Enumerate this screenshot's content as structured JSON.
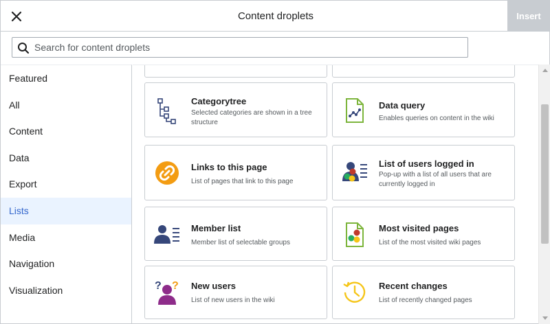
{
  "header": {
    "title": "Content droplets",
    "insert_label": "Insert",
    "close_icon": "close-icon"
  },
  "search": {
    "placeholder": "Search for content droplets",
    "value": ""
  },
  "sidebar": {
    "items": [
      {
        "label": "Featured",
        "active": false
      },
      {
        "label": "All",
        "active": false
      },
      {
        "label": "Content",
        "active": false
      },
      {
        "label": "Data",
        "active": false
      },
      {
        "label": "Export",
        "active": false
      },
      {
        "label": "Lists",
        "active": true
      },
      {
        "label": "Media",
        "active": false
      },
      {
        "label": "Navigation",
        "active": false
      },
      {
        "label": "Visualization",
        "active": false
      }
    ]
  },
  "droplets": [
    {
      "title": "Categorytree",
      "desc": "Selected categories are shown in a tree structure",
      "icon": "tree-icon"
    },
    {
      "title": "Data query",
      "desc": "Enables queries on content in the wiki",
      "icon": "chart-document-icon"
    },
    {
      "title": "Links to this page",
      "desc": "List of pages that link to this page",
      "icon": "link-icon"
    },
    {
      "title": "List of users logged in",
      "desc": "Pop-up with a list of all users that are currently logged in",
      "icon": "users-list-icon"
    },
    {
      "title": "Member list",
      "desc": "Member list of selectable groups",
      "icon": "member-list-icon"
    },
    {
      "title": "Most visited pages",
      "desc": "List of the most visited wiki pages",
      "icon": "ranked-document-icon"
    },
    {
      "title": "New users",
      "desc": "List of new users in the wiki",
      "icon": "new-user-icon"
    },
    {
      "title": "Recent changes",
      "desc": "List of recently changed pages",
      "icon": "history-clock-icon"
    }
  ],
  "colors": {
    "accent": "#3366cc",
    "active_bg": "#eaf3ff",
    "border": "#c8ccd1",
    "insert_disabled": "#c8ccd1",
    "icon_navy": "#36477a",
    "icon_green": "#7db53c",
    "icon_orange": "#f39c12",
    "icon_purple": "#8e2c8a",
    "icon_yellow": "#f5c518"
  }
}
